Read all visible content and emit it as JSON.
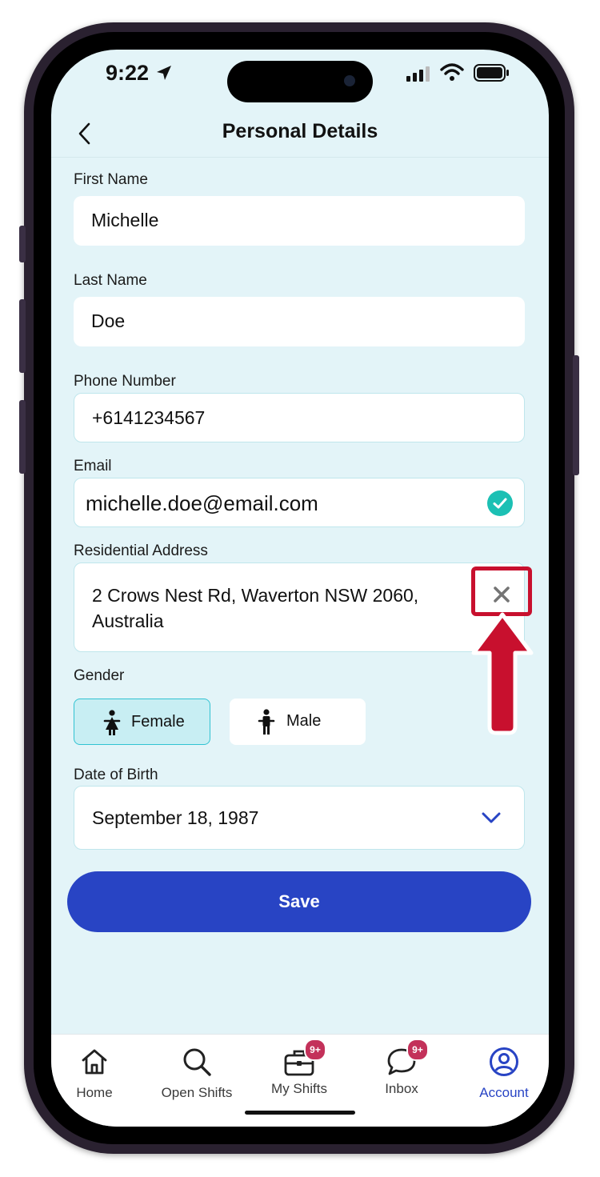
{
  "status_bar": {
    "time": "9:22"
  },
  "header": {
    "title": "Personal Details",
    "back_icon": "chevron-left-icon"
  },
  "form": {
    "first_name": {
      "label": "First Name",
      "value": "Michelle"
    },
    "last_name": {
      "label": "Last Name",
      "value": "Doe"
    },
    "phone": {
      "label": "Phone Number",
      "value": "+6141234567"
    },
    "email": {
      "label": "Email",
      "value": "michelle.doe@email.com",
      "status_icon": "check-circle-icon"
    },
    "address": {
      "label": "Residential Address",
      "line1": "2 Crows Nest Rd, Waverton NSW 2060,",
      "line2": "Australia",
      "clear_icon": "close-icon"
    },
    "gender": {
      "label": "Gender",
      "options": [
        "Female",
        "Male"
      ],
      "selected": "Female"
    },
    "dob": {
      "label": "Date of Birth",
      "value": "September 18, 1987",
      "dropdown_icon": "chevron-down-icon"
    }
  },
  "save_label": "Save",
  "tabs": [
    {
      "label": "Home",
      "icon": "home-icon"
    },
    {
      "label": "Open Shifts",
      "icon": "search-icon"
    },
    {
      "label": "My Shifts",
      "icon": "briefcase-icon",
      "badge": "9+"
    },
    {
      "label": "Inbox",
      "icon": "chat-icon",
      "badge": "9+"
    },
    {
      "label": "Account",
      "icon": "user-circle-icon",
      "active": true
    }
  ],
  "colors": {
    "accent": "#2844c4",
    "screen_bg": "#e3f4f8",
    "success": "#1cc0b4",
    "badge": "#c3315a",
    "annotation": "#c8102e"
  }
}
